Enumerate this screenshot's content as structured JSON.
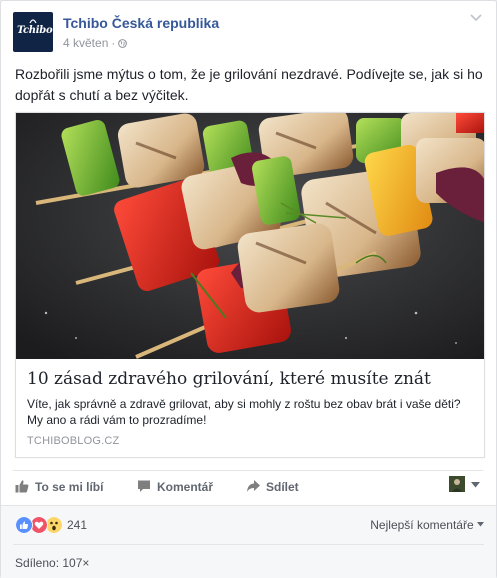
{
  "post": {
    "page_name": "Tchibo Česká republika",
    "date": "4 květen",
    "separator": "·",
    "avatar_logo_text": "Tchibo",
    "text": "Rozbořili jsme mýtus o tom, že je grilování nezdravé. Podívejte se, jak si ho dopřát s chutí a bez výčitek."
  },
  "link": {
    "title": "10 zásad zdravého grilování, které musíte znát",
    "description": "Víte, jak správně a zdravě grilovat, aby si mohly z roštu bez obav brát i vaše děti? My ano a rádi vám to prozradíme!",
    "domain": "TCHIBOBLOG.CZ"
  },
  "actions": {
    "like": "To se mi líbí",
    "comment": "Komentář",
    "share": "Sdílet"
  },
  "reactions": {
    "icons": [
      "like-icon",
      "love-icon",
      "wow-icon"
    ],
    "count": "241",
    "sort_label": "Nejlepší komentáře"
  },
  "shares": {
    "text": "Sdíleno: 107×"
  },
  "colors": {
    "link_blue": "#365899",
    "like_blue": "#5890ff",
    "love_red": "#f25268",
    "wow_yellow": "#fcd669",
    "avatar_navy": "#102446"
  }
}
